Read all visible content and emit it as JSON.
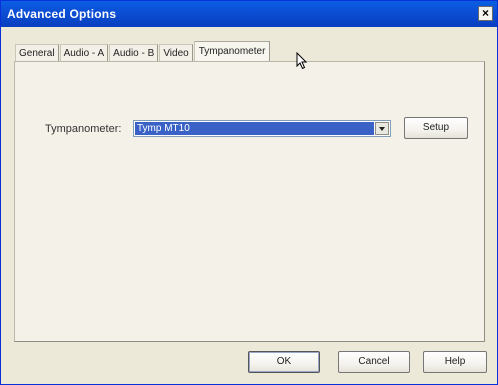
{
  "window": {
    "title": "Advanced Options",
    "close_label": "×"
  },
  "tabs": [
    {
      "label": "General",
      "active": false
    },
    {
      "label": "Audio - A",
      "active": false
    },
    {
      "label": "Audio - B",
      "active": false
    },
    {
      "label": "Video",
      "active": false
    },
    {
      "label": "Tympanometer",
      "active": true
    }
  ],
  "tympanometer": {
    "label": "Tympanometer:",
    "selected": "Tymp MT10",
    "setup_label": "Setup"
  },
  "footer": {
    "ok_label": "OK",
    "cancel_label": "Cancel",
    "help_label": "Help"
  },
  "colors": {
    "titlebar": "#0b4fd6",
    "selection": "#3a62c6",
    "dialog_bg": "#ece9d8"
  },
  "icons": {
    "close": "close-icon",
    "dropdown": "chevron-down-icon",
    "cursor": "mouse-pointer-icon"
  }
}
